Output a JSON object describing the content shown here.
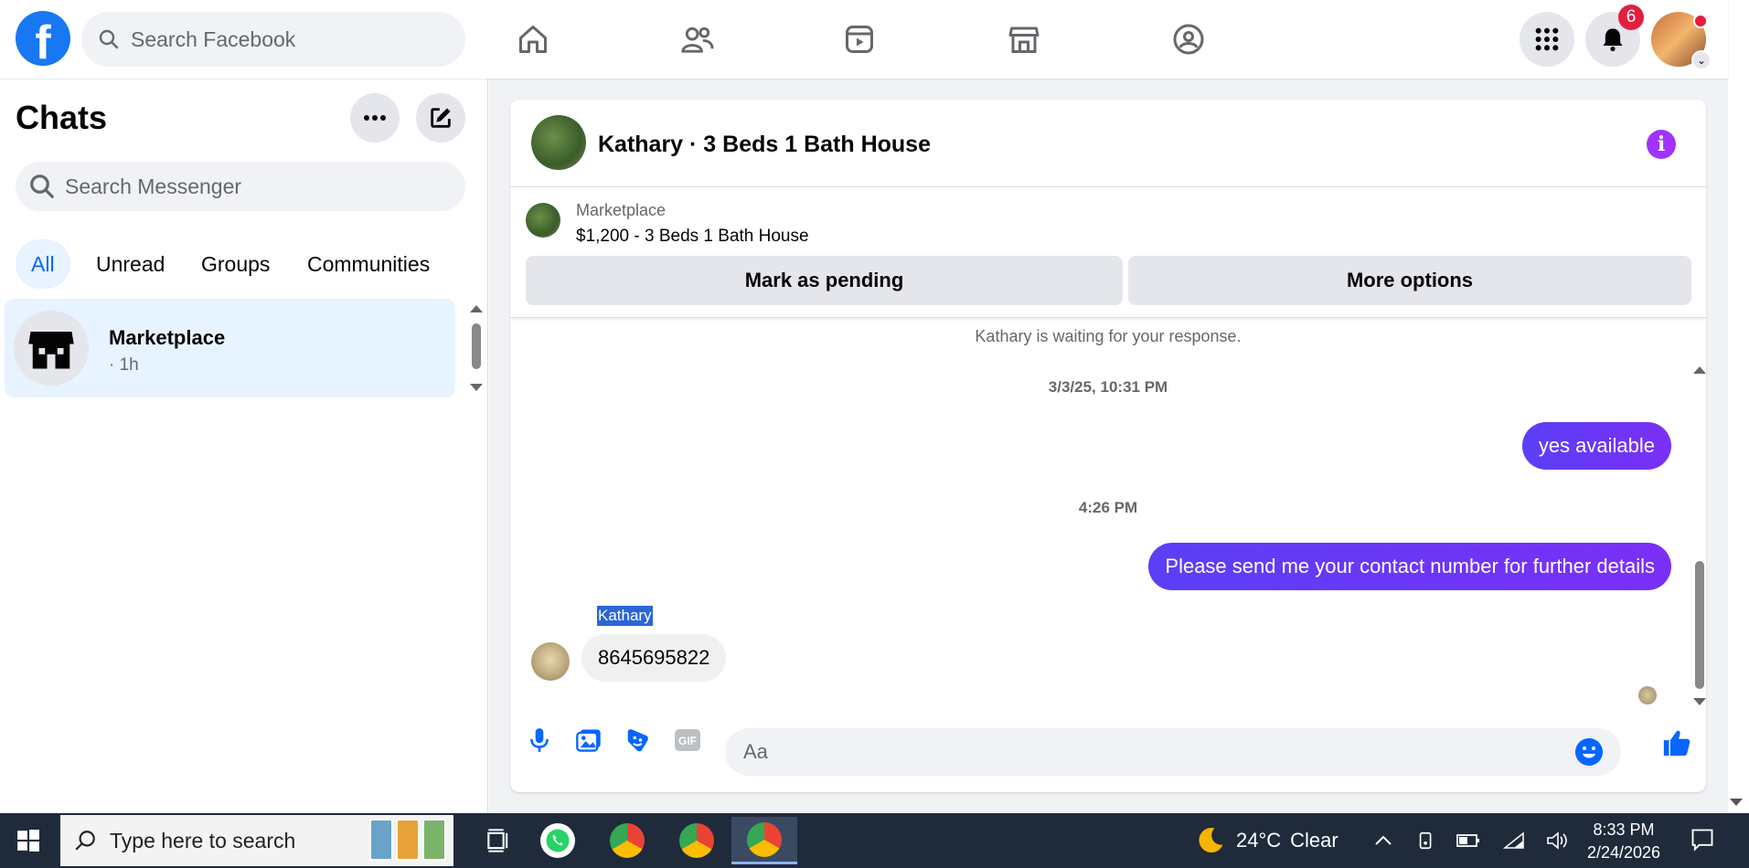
{
  "topbar": {
    "logo": "f",
    "search_placeholder": "Search Facebook",
    "notification_count": "6"
  },
  "sidebar": {
    "title": "Chats",
    "search_placeholder": "Search Messenger",
    "filters": [
      "All",
      "Unread",
      "Groups",
      "Communities"
    ],
    "chats": [
      {
        "name": "Marketplace",
        "time": "· 1h"
      }
    ]
  },
  "conversation": {
    "title": "Kathary · 3 Beds 1 Bath House",
    "marketplace_label": "Marketplace",
    "listing": "$1,200 - 3 Beds 1 Bath House",
    "mark_pending": "Mark as pending",
    "more_options": "More options",
    "notice": "Kathary is waiting for your response.",
    "messages": [
      {
        "type": "timestamp",
        "text": "3/3/25, 10:31 PM"
      },
      {
        "type": "outgoing",
        "text": "yes available"
      },
      {
        "type": "timestamp",
        "text": "4:26 PM"
      },
      {
        "type": "outgoing",
        "text": "Please send me your contact number for further details"
      },
      {
        "type": "incoming",
        "sender": "Kathary",
        "text": "8645695822"
      }
    ],
    "composer_placeholder": "Aa",
    "gif_label": "GIF"
  },
  "taskbar": {
    "search_placeholder": "Type here to search",
    "weather_temp": "24°C",
    "weather_cond": "Clear",
    "time": "8:33 PM",
    "date": "2/24/2026"
  },
  "colors": {
    "brand": "#1877f2",
    "bubble": "#6b36f7",
    "accent": "#0866ff"
  }
}
